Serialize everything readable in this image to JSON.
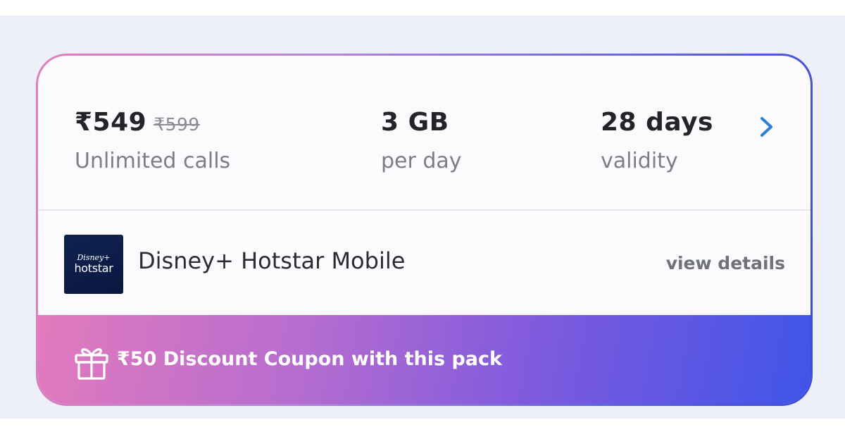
{
  "plan": {
    "price": "₹549",
    "original_price": "₹599",
    "price_sub": "Unlimited calls",
    "data": "3 GB",
    "data_sub": "per day",
    "validity": "28 days",
    "validity_sub": "validity"
  },
  "ott": {
    "logo_line1": "Disney+",
    "logo_line2": "hotstar",
    "name": "Disney+ Hotstar Mobile",
    "view_details": "view details"
  },
  "coupon": {
    "text": "₹50 Discount Coupon with this pack"
  },
  "icons": {
    "chevron": "chevron-right-icon",
    "gift": "gift-icon"
  },
  "colors": {
    "chevron": "#2f7fd6",
    "gradient_start": "#e27abd",
    "gradient_end": "#3f55e8",
    "logo_bg": "#0f2350"
  }
}
